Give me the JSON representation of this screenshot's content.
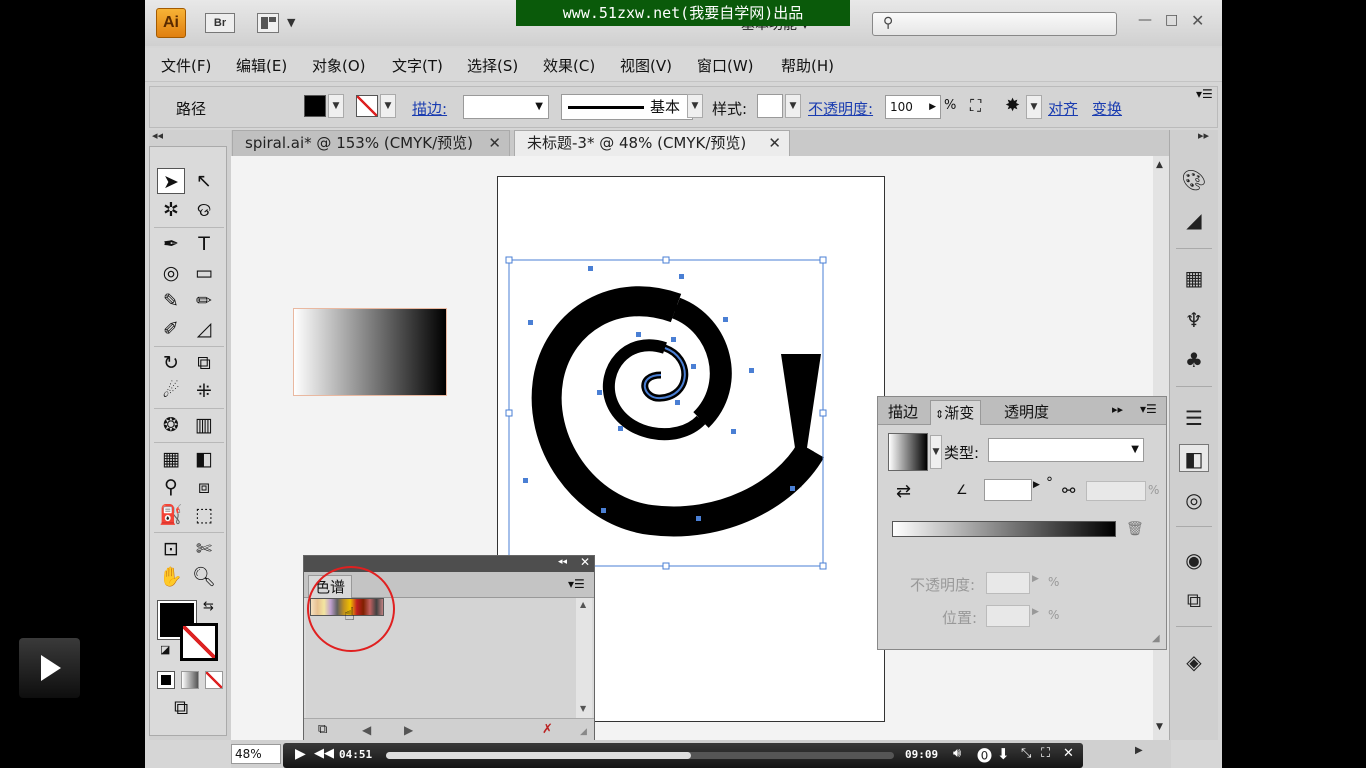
{
  "titlebar": {
    "app_logo": "Ai",
    "bridge_label": "Br",
    "watermark": "www.51zxw.net(我要自学网)出品",
    "workspace": "基本功能",
    "window_controls": {
      "minimize": "—",
      "maximize": "□",
      "close": "✕"
    }
  },
  "menu": [
    "文件(F)",
    "编辑(E)",
    "对象(O)",
    "文字(T)",
    "选择(S)",
    "效果(C)",
    "视图(V)",
    "窗口(W)",
    "帮助(H)"
  ],
  "control_bar": {
    "object_type": "路径",
    "stroke_label": "描边:",
    "stroke_profile": "基本",
    "style_label": "样式:",
    "opacity_label": "不透明度:",
    "opacity_value": "100",
    "opacity_unit": "%",
    "align_label": "对齐",
    "transform_label": "变换"
  },
  "tabs": [
    {
      "label": "spiral.ai* @ 153% (CMYK/预览)",
      "close": "✕"
    },
    {
      "label": "未标题-3* @ 48% (CMYK/预览)",
      "close": "✕"
    }
  ],
  "gradient_panel": {
    "tabs": [
      "描边",
      "渐变",
      "透明度"
    ],
    "type_label": "类型:",
    "degree_symbol": "°",
    "opacity_label": "不透明度:",
    "position_label": "位置:",
    "percent": "%"
  },
  "swatch_panel": {
    "tab": "色谱"
  },
  "status": {
    "zoom": "48%"
  },
  "player": {
    "current_time": "04:51",
    "total_time": "09:09",
    "progress": 0.6
  },
  "colors": {
    "accent_link": "#1a3cb0",
    "selection_blue": "#4a7fd4",
    "watermark_bg": "#0a5a0a",
    "highlight_circle": "#e02020"
  }
}
